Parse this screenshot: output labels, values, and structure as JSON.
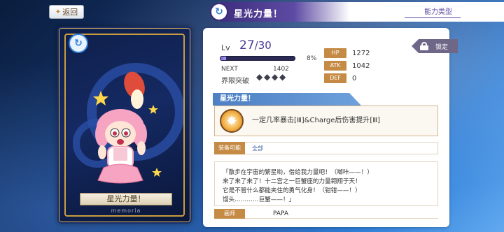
{
  "header": {
    "back_label": "返回",
    "title": "星光力量！",
    "ability_type_label": "能力类型"
  },
  "card": {
    "name": "星光力量！",
    "subtitle": "memoria"
  },
  "lock": {
    "label": "锁定"
  },
  "level": {
    "label": "Lv",
    "current": "27",
    "max": "/30",
    "exp_percent_text": "8%",
    "exp_fraction": 0.08,
    "next_label": "NEXT",
    "next_value": "1402",
    "limit_break_label": "界限突破",
    "limit_break_diamonds": 4
  },
  "stats": [
    {
      "tag": "HP",
      "value": "1272"
    },
    {
      "tag": "ATK",
      "value": "1042"
    },
    {
      "tag": "DEF",
      "value": "0"
    }
  ],
  "skill": {
    "header": "星光力量！",
    "description": "一定几率暴击[Ⅲ]&Charge后伤害提升[Ⅲ]"
  },
  "equip": {
    "label": "装备可能",
    "value": "全部"
  },
  "quote": {
    "lines": [
      "「散步在宇宙的繁星哟，借给我力量吧！（啷咔——！）",
      "来了来了来了！十二宫之一巨蟹座的力量翱翔于天！",
      "它是不管什么都能夹住的勇气化身！（钳钳——！）",
      "馒头…………巨蟹——！」"
    ]
  },
  "artist": {
    "label": "画师",
    "name": "PAPA"
  },
  "colors": {
    "accent_purple": "#3b2a7a",
    "tag_orange": "#c58b45",
    "skill_blue": "#4d7fc3"
  }
}
